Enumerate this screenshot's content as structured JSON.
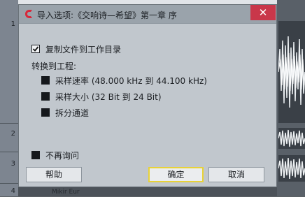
{
  "background": {
    "track_numbers": [
      "1",
      "2",
      "3",
      "4"
    ],
    "bottom_label": "Mikir Eur"
  },
  "dialog": {
    "title": "导入选项:《交响诗—希望》第一章 序",
    "close_symbol": "✕",
    "copy_option": {
      "label": "复制文件到工作目录",
      "checked": true
    },
    "convert_heading": "转换到工程:",
    "convert_options": [
      {
        "label": "采样速率 (48.000 kHz 到 44.100 kHz)",
        "checked": false
      },
      {
        "label": "采样大小 (32 Bit 到 24 Bit)",
        "checked": false
      },
      {
        "label": "拆分通道",
        "checked": false
      }
    ],
    "dont_ask": {
      "label": "不再询问",
      "checked": false
    },
    "buttons": {
      "help": "帮助",
      "ok": "确定",
      "cancel": "取消"
    }
  },
  "colors": {
    "accent_close": "#c9374a",
    "default_button_border": "#e8d238",
    "app_icon": "#d8283a"
  }
}
